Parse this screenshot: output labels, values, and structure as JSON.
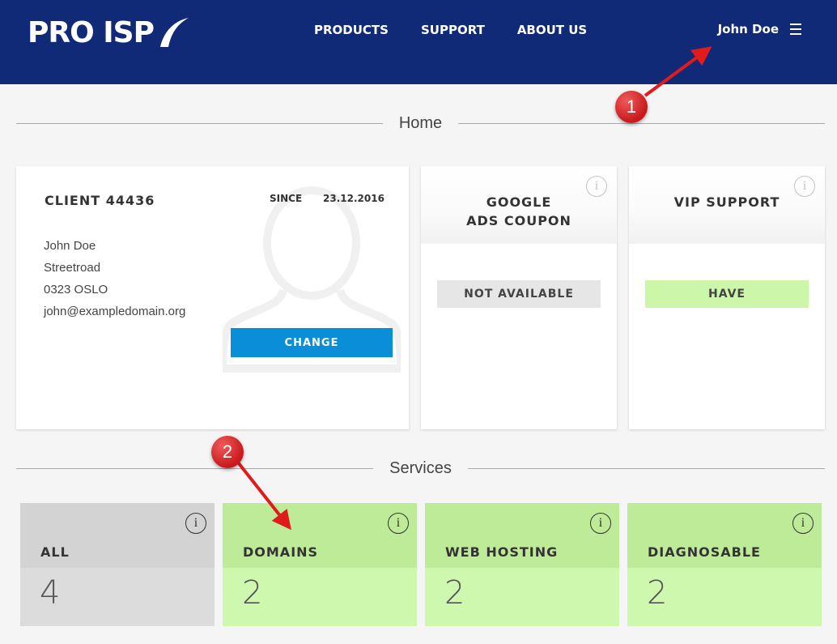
{
  "header": {
    "logo_text": "PRO ISP",
    "nav": [
      "PRODUCTS",
      "SUPPORT",
      "ABOUT US"
    ],
    "user_name": "John Doe"
  },
  "home": {
    "section_title": "Home",
    "client": {
      "title": "CLIENT 44436",
      "since_label": "SINCE",
      "since_date": "23.12.2016",
      "name": "John Doe",
      "street": "Streetroad",
      "city": "0323 OSLO",
      "email": "john@exampledomain.org",
      "change_label": "CHANGE"
    },
    "google": {
      "title_line1": "GOOGLE",
      "title_line2": "ADS COUPON",
      "status": "NOT AVAILABLE"
    },
    "vip": {
      "title": "VIP SUPPORT",
      "status": "HAVE"
    }
  },
  "services": {
    "section_title": "Services",
    "tiles": [
      {
        "label": "ALL",
        "count": "4"
      },
      {
        "label": "DOMAINS",
        "count": "2"
      },
      {
        "label": "WEB HOSTING",
        "count": "2"
      },
      {
        "label": "DIAGNOSABLE",
        "count": "2"
      }
    ]
  },
  "annotations": {
    "badge1": "1",
    "badge2": "2",
    "color": "#d51f1f"
  },
  "colors": {
    "header_bg": "#112a78",
    "button_blue": "#0b8ed8",
    "green_tile": "#cef8ad",
    "gray_tile": "#dcdcdc"
  }
}
